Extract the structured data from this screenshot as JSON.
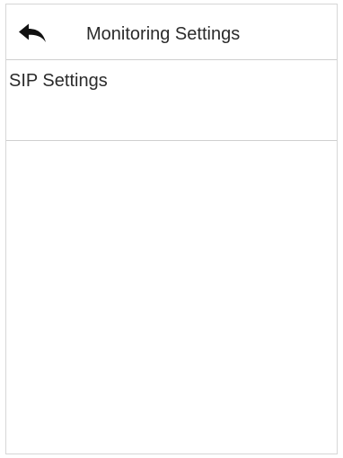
{
  "header": {
    "title": "Monitoring Settings",
    "back_icon": "back-arrow-icon"
  },
  "menu": {
    "items": [
      {
        "label": "SIP Settings"
      }
    ]
  }
}
